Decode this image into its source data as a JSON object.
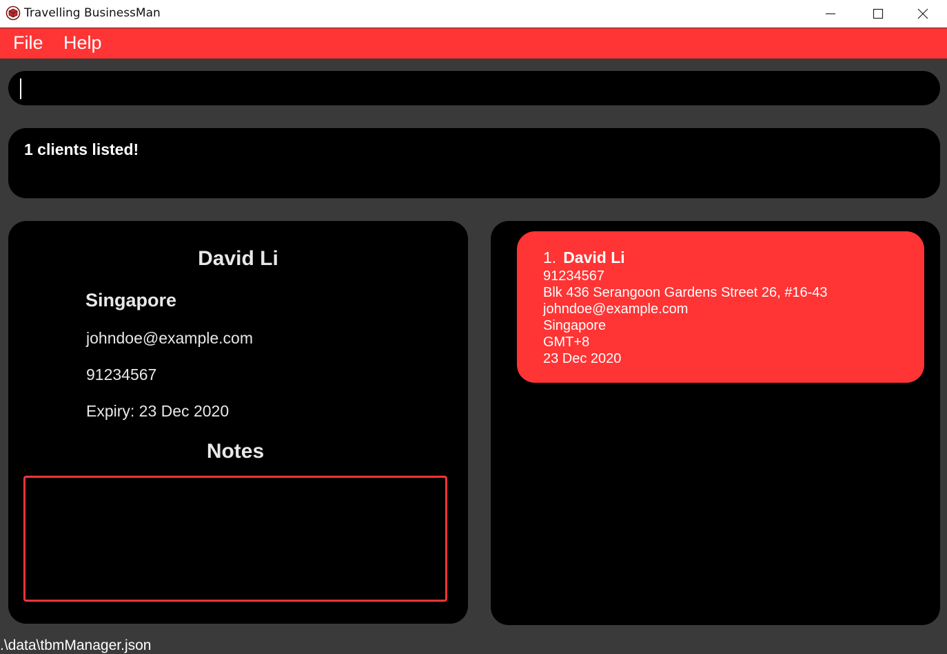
{
  "window": {
    "title": "Travelling BusinessMan",
    "icon": "app-logo-icon",
    "controls": [
      "minimize-icon",
      "maximize-icon",
      "close-icon"
    ]
  },
  "menu": {
    "file_label": "File",
    "help_label": "Help"
  },
  "command": {
    "value": "",
    "placeholder": ""
  },
  "result": {
    "message": "1 clients listed!"
  },
  "detail": {
    "name": "David Li",
    "location": "Singapore",
    "email": "johndoe@example.com",
    "phone": "91234567",
    "expiry": "Expiry: 23 Dec 2020",
    "notes_heading": "Notes",
    "notes_value": ""
  },
  "clients": [
    {
      "index": "1.",
      "name": "David Li",
      "phone": "91234567",
      "address": "Blk 436 Serangoon Gardens Street 26, #16-43",
      "email": "johndoe@example.com",
      "country": "Singapore",
      "timezone": "GMT+8",
      "expiry": "23 Dec 2020"
    }
  ],
  "status": {
    "path": ".\\data\\tbmManager.json"
  },
  "colors": {
    "accent": "#ff3434",
    "background": "#3a3a3a",
    "panel": "#000000",
    "text": "#ffffff"
  }
}
